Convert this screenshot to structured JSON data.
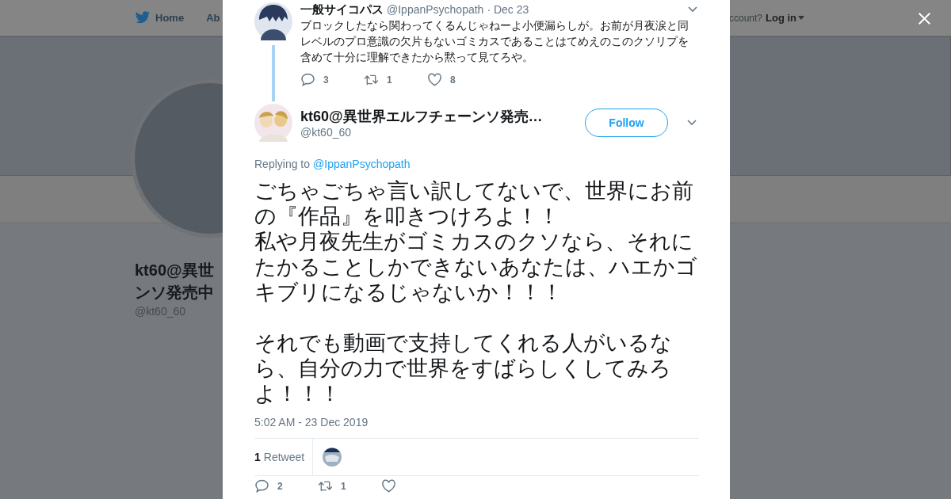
{
  "background_page": {
    "nav": [
      {
        "kind": "home",
        "label": "Home"
      },
      {
        "kind": "plain",
        "label": "Ab"
      }
    ],
    "account_prompt": "ccount?",
    "login": "Log in",
    "profile_name_lines": [
      "kt60@異世",
      "ンソ発売中"
    ],
    "profile_handle": "@kt60_60"
  },
  "parent_tweet": {
    "name": "一般サイコパス",
    "handle": "@IppanPsychopath",
    "date": "· Dec 23",
    "text": "ブロックしたなら関わってくるんじゃねーよ小便漏らしが。お前が月夜涙と同レベルのプロ意識の欠片もないゴミカスであることはてめえのこのクソリプを含めて十分に理解できたから黙って見てろや。",
    "actions": [
      {
        "kind": "reply",
        "count": "3"
      },
      {
        "kind": "retweet",
        "count": "1"
      },
      {
        "kind": "like",
        "count": "8"
      }
    ]
  },
  "tweet": {
    "name": "kt60@異世界エルフチェーンソ発売…",
    "handle": "@kt60_60",
    "follow_label": "Follow",
    "replying_prefix": "Replying to",
    "replying_to": "@IppanPsychopath",
    "paragraph_groups": [
      [
        "ごちゃごちゃ言い訳してないで、世界にお前の『作品』を叩きつけろよ！！",
        "私や月夜先生がゴミカスのクソなら、それにたかることしかできないあなたは、ハエかゴキブリになるじゃないか！！！"
      ],
      [
        "それでも動画で支持してくれる人がいるなら、自分の力で世界をすばらしくしてみろよ！！！"
      ]
    ],
    "timestamp": "5:02 AM - 23 Dec 2019",
    "retweet_count": "1",
    "retweet_label": "Retweet",
    "actions": [
      {
        "kind": "reply",
        "count": "2"
      },
      {
        "kind": "retweet",
        "count": "1"
      },
      {
        "kind": "like"
      }
    ]
  }
}
